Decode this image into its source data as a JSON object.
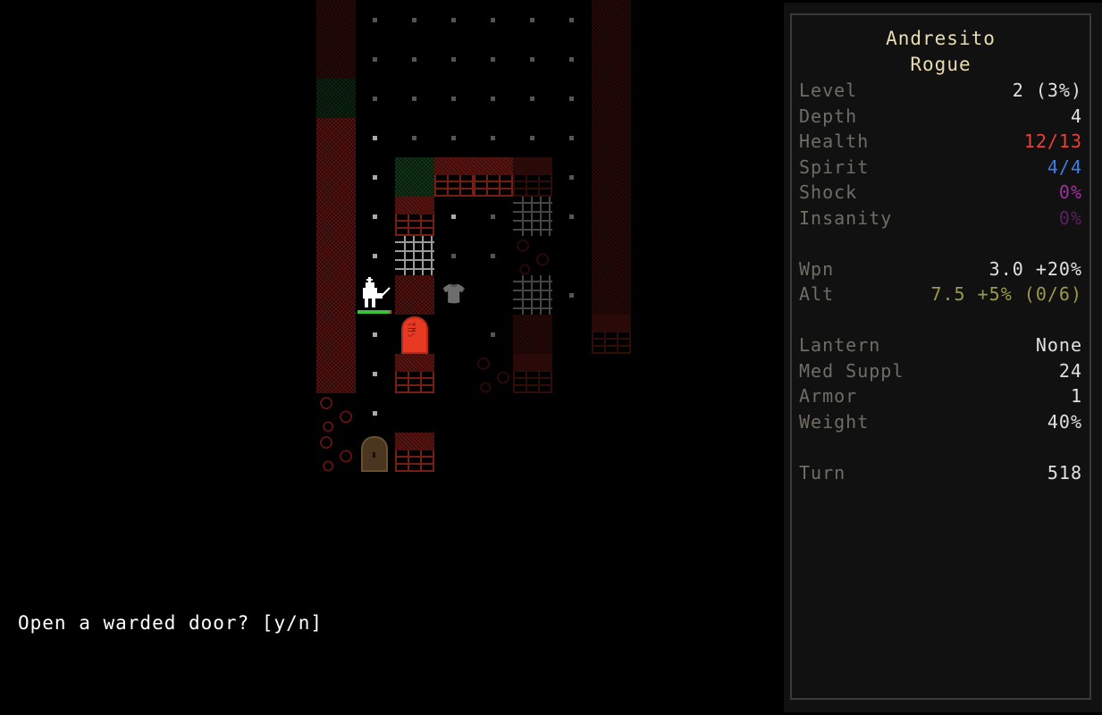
{
  "map": {
    "cols": 8,
    "rows": 12,
    "tiles": [
      {
        "c": 0,
        "r": 0,
        "t": "wall-red",
        "dim": true
      },
      {
        "c": 0,
        "r": 1,
        "t": "wall-red",
        "dim": true
      },
      {
        "c": 0,
        "r": 2,
        "t": "wall-green",
        "dim": true
      },
      {
        "c": 0,
        "r": 3,
        "t": "wall-red"
      },
      {
        "c": 0,
        "r": 4,
        "t": "wall-red"
      },
      {
        "c": 0,
        "r": 5,
        "t": "wall-red"
      },
      {
        "c": 0,
        "r": 6,
        "t": "wall-red"
      },
      {
        "c": 0,
        "r": 7,
        "t": "wall-red"
      },
      {
        "c": 0,
        "r": 8,
        "t": "wall-red"
      },
      {
        "c": 0,
        "r": 9,
        "t": "wall-red"
      },
      {
        "c": 0,
        "r": 10,
        "t": "cobble"
      },
      {
        "c": 0,
        "r": 11,
        "t": "cobble"
      },
      {
        "c": 1,
        "r": 0,
        "t": "floor"
      },
      {
        "c": 1,
        "r": 1,
        "t": "floor"
      },
      {
        "c": 1,
        "r": 2,
        "t": "floor"
      },
      {
        "c": 1,
        "r": 3,
        "t": "floor",
        "lit": true
      },
      {
        "c": 1,
        "r": 4,
        "t": "floor",
        "lit": true
      },
      {
        "c": 1,
        "r": 5,
        "t": "floor",
        "lit": true
      },
      {
        "c": 1,
        "r": 6,
        "t": "floor",
        "lit": true
      },
      {
        "c": 1,
        "r": 7,
        "t": "player"
      },
      {
        "c": 1,
        "r": 8,
        "t": "floor",
        "lit": true
      },
      {
        "c": 1,
        "r": 9,
        "t": "floor",
        "lit": true
      },
      {
        "c": 1,
        "r": 10,
        "t": "floor",
        "lit": true
      },
      {
        "c": 1,
        "r": 11,
        "t": "door-wood"
      },
      {
        "c": 2,
        "r": 0,
        "t": "floor"
      },
      {
        "c": 2,
        "r": 1,
        "t": "floor"
      },
      {
        "c": 2,
        "r": 2,
        "t": "floor"
      },
      {
        "c": 2,
        "r": 3,
        "t": "floor"
      },
      {
        "c": 2,
        "r": 4,
        "t": "wall-green"
      },
      {
        "c": 2,
        "r": 5,
        "t": "brick"
      },
      {
        "c": 2,
        "r": 6,
        "t": "grate"
      },
      {
        "c": 2,
        "r": 7,
        "t": "wall-red"
      },
      {
        "c": 2,
        "r": 8,
        "t": "door-warded"
      },
      {
        "c": 2,
        "r": 9,
        "t": "brick"
      },
      {
        "c": 2,
        "r": 11,
        "t": "brick"
      },
      {
        "c": 3,
        "r": 0,
        "t": "floor"
      },
      {
        "c": 3,
        "r": 1,
        "t": "floor"
      },
      {
        "c": 3,
        "r": 2,
        "t": "floor"
      },
      {
        "c": 3,
        "r": 3,
        "t": "floor"
      },
      {
        "c": 3,
        "r": 4,
        "t": "brick"
      },
      {
        "c": 3,
        "r": 5,
        "t": "floor",
        "lit": true
      },
      {
        "c": 3,
        "r": 6,
        "t": "floor"
      },
      {
        "c": 3,
        "r": 7,
        "t": "item-armor"
      },
      {
        "c": 4,
        "r": 0,
        "t": "floor"
      },
      {
        "c": 4,
        "r": 1,
        "t": "floor"
      },
      {
        "c": 4,
        "r": 2,
        "t": "floor"
      },
      {
        "c": 4,
        "r": 3,
        "t": "floor"
      },
      {
        "c": 4,
        "r": 4,
        "t": "brick"
      },
      {
        "c": 4,
        "r": 5,
        "t": "floor"
      },
      {
        "c": 4,
        "r": 6,
        "t": "floor"
      },
      {
        "c": 4,
        "r": 8,
        "t": "floor"
      },
      {
        "c": 4,
        "r": 9,
        "t": "cobble",
        "dim": true
      },
      {
        "c": 5,
        "r": 0,
        "t": "floor"
      },
      {
        "c": 5,
        "r": 1,
        "t": "floor"
      },
      {
        "c": 5,
        "r": 2,
        "t": "floor"
      },
      {
        "c": 5,
        "r": 3,
        "t": "floor"
      },
      {
        "c": 5,
        "r": 4,
        "t": "brick",
        "dim": true
      },
      {
        "c": 5,
        "r": 5,
        "t": "grate",
        "dim": true
      },
      {
        "c": 5,
        "r": 6,
        "t": "cobble",
        "dim": true
      },
      {
        "c": 5,
        "r": 7,
        "t": "grate",
        "dim": true
      },
      {
        "c": 5,
        "r": 8,
        "t": "wall-red",
        "dim": true
      },
      {
        "c": 5,
        "r": 9,
        "t": "brick",
        "dim": true
      },
      {
        "c": 6,
        "r": 0,
        "t": "floor"
      },
      {
        "c": 6,
        "r": 1,
        "t": "floor"
      },
      {
        "c": 6,
        "r": 2,
        "t": "floor"
      },
      {
        "c": 6,
        "r": 3,
        "t": "floor"
      },
      {
        "c": 6,
        "r": 4,
        "t": "floor"
      },
      {
        "c": 6,
        "r": 5,
        "t": "floor"
      },
      {
        "c": 6,
        "r": 7,
        "t": "floor"
      },
      {
        "c": 7,
        "r": 0,
        "t": "wall-red",
        "dim": true
      },
      {
        "c": 7,
        "r": 1,
        "t": "wall-red",
        "dim": true
      },
      {
        "c": 7,
        "r": 2,
        "t": "wall-red",
        "dim": true
      },
      {
        "c": 7,
        "r": 3,
        "t": "wall-red",
        "dim": true
      },
      {
        "c": 7,
        "r": 4,
        "t": "wall-red",
        "dim": true
      },
      {
        "c": 7,
        "r": 5,
        "t": "wall-red",
        "dim": true
      },
      {
        "c": 7,
        "r": 6,
        "t": "wall-red",
        "dim": true
      },
      {
        "c": 7,
        "r": 7,
        "t": "wall-red",
        "dim": true
      },
      {
        "c": 7,
        "r": 8,
        "t": "brick",
        "dim": true
      }
    ],
    "player_health_fraction": 0.923
  },
  "character": {
    "name": "Andresito",
    "class": "Rogue"
  },
  "stats": [
    {
      "label": "Level",
      "value": "2 (3%)",
      "color": "#e0e0e0"
    },
    {
      "label": "Depth",
      "value": "4",
      "color": "#e0e0e0"
    },
    {
      "label": "Health",
      "value": "12/13",
      "color": "#e8403a"
    },
    {
      "label": "Spirit",
      "value": "4/4",
      "color": "#3a7ee8"
    },
    {
      "label": "Shock",
      "value": "0%",
      "color": "#a030a0"
    },
    {
      "label": "Insanity",
      "value": "0%",
      "color": "#5a2060"
    },
    {
      "label": "",
      "value": ""
    },
    {
      "label": "Wpn",
      "value": "3.0 +20%",
      "color": "#e0e0e0"
    },
    {
      "label": "Alt",
      "value": "7.5 +5% (0/6)",
      "color": "#9a9a4a"
    },
    {
      "label": "",
      "value": ""
    },
    {
      "label": "Lantern",
      "value": "None",
      "color": "#e0e0e0"
    },
    {
      "label": "Med Suppl",
      "value": "24",
      "color": "#e0e0e0"
    },
    {
      "label": "Armor",
      "value": "1",
      "color": "#e0e0e0"
    },
    {
      "label": "Weight",
      "value": "40%",
      "color": "#e0e0e0"
    },
    {
      "label": "",
      "value": ""
    },
    {
      "label": "Turn",
      "value": "518",
      "color": "#e0e0e0"
    }
  ],
  "message": "Open a warded door? [y/n]"
}
